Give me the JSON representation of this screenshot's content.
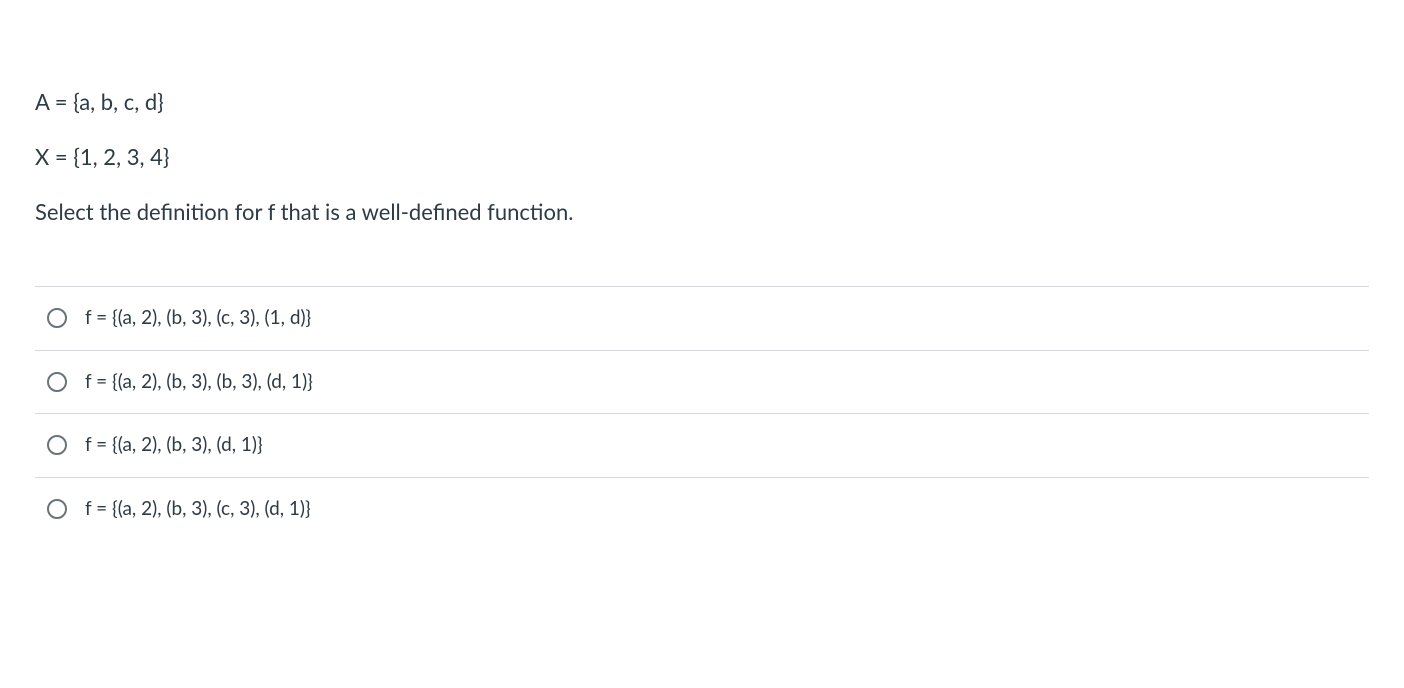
{
  "question": {
    "line1": "A = {a, b, c, d}",
    "line2": "X = {1, 2, 3, 4}",
    "prompt": "Select the definition for f that is a well-defined function."
  },
  "options": [
    {
      "label": "f = {(a, 2), (b, 3), (c, 3), (1, d)}"
    },
    {
      "label": "f = {(a, 2), (b, 3), (b, 3), (d, 1)}"
    },
    {
      "label": "f = {(a, 2), (b, 3), (d, 1)}"
    },
    {
      "label": "f = {(a, 2), (b, 3), (c, 3), (d, 1)}"
    }
  ]
}
